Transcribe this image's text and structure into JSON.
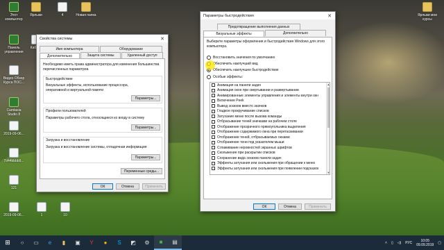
{
  "desktop": {
    "icons": [
      {
        "label": "Этот компьютер",
        "kind": "app"
      },
      {
        "label": "Ярлыки",
        "kind": "folder"
      },
      {
        "label": "4",
        "kind": "doc"
      },
      {
        "label": "Новая папка",
        "kind": "folder"
      },
      {
        "label": "Панель управления",
        "kind": "app"
      },
      {
        "label": "Кабель",
        "kind": "doc"
      },
      {
        "label": "Видео Обзор Курса ПОС...",
        "kind": "doc"
      },
      {
        "label": "Camtasia Studio 8",
        "kind": "app"
      },
      {
        "label": "2019-09-06...",
        "kind": "doc"
      },
      {
        "label": "7d44bbbb9...",
        "kind": "doc"
      },
      {
        "label": "121",
        "kind": "doc"
      },
      {
        "label": "2019-09-06...",
        "kind": "doc"
      },
      {
        "label": "1",
        "kind": "doc"
      },
      {
        "label": "10",
        "kind": "doc"
      },
      {
        "label": "Ярлыки мои курсы",
        "kind": "folder"
      }
    ]
  },
  "sysprops": {
    "title": "Свойства системы",
    "tabs_row1": [
      "Имя компьютера",
      "Оборудование"
    ],
    "tabs_row2": [
      "Дополнительно",
      "Защита системы",
      "Удаленный доступ"
    ],
    "admin_note": "Необходимо иметь права администратора для изменения большинства перечисленных параметров.",
    "perf_title": "Быстродействие",
    "perf_text": "Визуальные эффекты, использование процессора, оперативной и виртуальной памяти",
    "perf_btn": "Параметры...",
    "profiles_title": "Профили пользователей",
    "profiles_text": "Параметры рабочего стола, относящиеся ко входу в систему",
    "profiles_btn": "Параметры...",
    "startup_title": "Загрузка и восстановление",
    "startup_text": "Загрузка и восстановление системы, отладочная информация",
    "startup_btn": "Параметры...",
    "env_btn": "Переменные среды...",
    "ok": "ОК",
    "cancel": "Отмена",
    "apply": "Применить"
  },
  "perfopts": {
    "title": "Параметры быстродействия",
    "tab_dep": "Предотвращение выполнения данных",
    "tab_visual": "Визуальные эффекты",
    "tab_advanced": "Дополнительно",
    "intro": "Выберите параметры оформления и быстродействия Windows для этого компьютера.",
    "radios": [
      {
        "label": "Восстановить значения по умолчанию",
        "selected": false
      },
      {
        "label": "Обеспечить наилучший вид",
        "selected": false
      },
      {
        "label": "Обеспечить наилучшее быстродействие",
        "selected": true
      },
      {
        "label": "Особые эффекты:",
        "selected": false
      }
    ],
    "effects": [
      "Анимация на панели задач",
      "Анимация окон при свертывании и развертывании",
      "Анимированные элементы управления и элементы внутри окн",
      "Включение Peek",
      "Вывод эскизов вместо значков",
      "Гладкое прокручивание списков",
      "Затухание меню после вызова команды",
      "Отбрасывание теней значками на рабочем столе",
      "Отображение прозрачного прямоугольника выделения",
      "Отображение содержимого окна при перетаскивании",
      "Отображение теней, отбрасываемых окнами",
      "Отображение тени под указателем мыши",
      "Сглаживание неровностей экранных шрифтов",
      "Скольжение при раскрытии списков",
      "Сохранение вида эскизов панели задач",
      "Эффекты затухания или скольжения при обращении к меню",
      "Эффекты затухания или скольжения при появлении подсказок"
    ],
    "ok": "ОК",
    "cancel": "Отмена",
    "apply": "Применить"
  },
  "taskbar": {
    "icons": [
      "windows-start-icon",
      "search-icon",
      "task-view-icon",
      "edge-icon",
      "folder-icon",
      "store-icon",
      "yandex-icon",
      "chrome-icon",
      "skype-icon",
      "photos-icon",
      "settings-icon",
      "camtasia-icon",
      "system-icon"
    ],
    "lang": "РУС",
    "time": "10:05",
    "date": "09.09.2019"
  }
}
